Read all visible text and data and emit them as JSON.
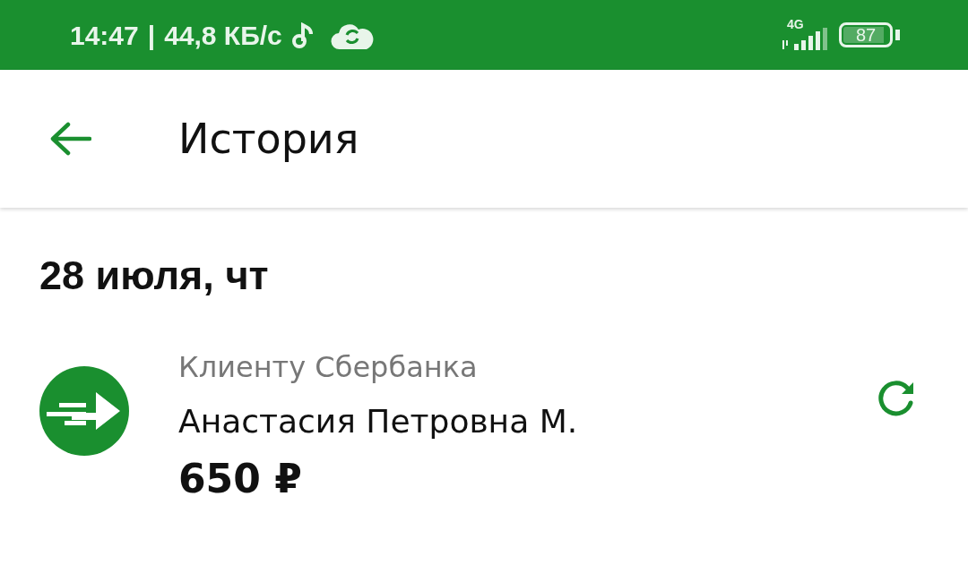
{
  "status_bar": {
    "time": "14:47",
    "separator": "|",
    "speed": "44,8 КБ/с",
    "network": "4G",
    "battery": "87"
  },
  "header": {
    "title": "История"
  },
  "groups": [
    {
      "date": "28 июля, чт",
      "operations": [
        {
          "category": "Клиенту Сбербанка",
          "name": "Анастасия Петровна М.",
          "amount": "650 ₽"
        }
      ]
    }
  ]
}
